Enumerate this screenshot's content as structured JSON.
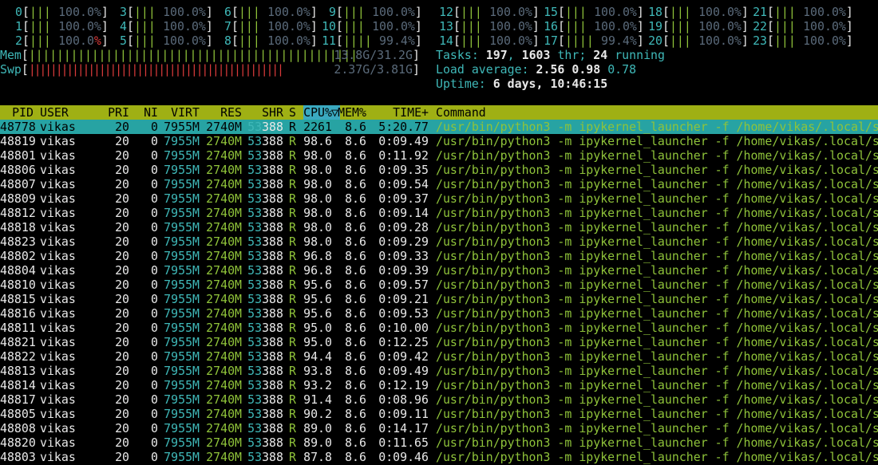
{
  "cpus": [
    {
      "id": "0",
      "bars": "|||",
      "pct": "100.0%"
    },
    {
      "id": "1",
      "bars": "|||",
      "pct": "100.0%"
    },
    {
      "id": "2",
      "bars": "|||",
      "pct": "100.0%"
    },
    {
      "id": "3",
      "bars": "|||",
      "pct": "100.0%"
    },
    {
      "id": "4",
      "bars": "|||",
      "pct": "100.0%"
    },
    {
      "id": "5",
      "bars": "|||",
      "pct": "100.0%"
    },
    {
      "id": "6",
      "bars": "|||",
      "pct": "100.0%"
    },
    {
      "id": "7",
      "bars": "|||",
      "pct": "100.0%"
    },
    {
      "id": "8",
      "bars": "|||",
      "pct": "100.0%"
    },
    {
      "id": "9",
      "bars": "|||",
      "pct": "100.0%"
    },
    {
      "id": "10",
      "bars": "|||",
      "pct": "100.0%"
    },
    {
      "id": "11",
      "bars": "||||",
      "pct": "99.4%"
    },
    {
      "id": "12",
      "bars": "|||",
      "pct": "100.0%"
    },
    {
      "id": "13",
      "bars": "|||",
      "pct": "100.0%"
    },
    {
      "id": "14",
      "bars": "|||",
      "pct": "100.0%"
    },
    {
      "id": "15",
      "bars": "|||",
      "pct": "100.0%"
    },
    {
      "id": "16",
      "bars": "|||",
      "pct": "100.0%"
    },
    {
      "id": "17",
      "bars": "||||",
      "pct": "99.4%"
    },
    {
      "id": "18",
      "bars": "|||",
      "pct": "100.0%"
    },
    {
      "id": "19",
      "bars": "|||",
      "pct": "100.0%"
    },
    {
      "id": "20",
      "bars": "|||",
      "pct": "100.0%"
    },
    {
      "id": "21",
      "bars": "|||",
      "pct": "100.0%"
    },
    {
      "id": "22",
      "bars": "|||",
      "pct": "100.0%"
    },
    {
      "id": "23",
      "bars": "|||",
      "pct": "100.0%"
    }
  ],
  "mem": {
    "label": "Mem",
    "bars": "|||||||||||||||||||||||||||||||||||||||||||||||",
    "value": "13.8G/31.2G"
  },
  "swp": {
    "label": "Swp",
    "bars": "|||||||||||||||||||||||||||||||||||||||||||||||",
    "value": "2.37G/3.81G"
  },
  "tasks": {
    "label": "Tasks:",
    "count": "197",
    "sep": ",",
    "thr": "1603",
    "thr_label": "thr;",
    "running": "24",
    "running_label": "running"
  },
  "load": {
    "label": "Load average:",
    "v1": "2.56",
    "v5": "0.98",
    "v15": "0.78"
  },
  "uptime": {
    "label": "Uptime:",
    "value": "6 days, 10:46:15"
  },
  "colors": {
    "header_bg": "#9fb014",
    "sort_bg": "#3aa9c0",
    "selected_bg": "#27a3a3"
  },
  "columns": {
    "pid": "PID",
    "user": "USER",
    "pri": "PRI",
    "ni": "NI",
    "virt": "VIRT",
    "res": "RES",
    "shr": "SHR",
    "s": "S",
    "cpu": "CPU%",
    "sort_arrow": "▽",
    "mem": "MEM%",
    "time": "TIME+",
    "command": "Command"
  },
  "command": {
    "prog": "/usr/bin/python3",
    "args": " -m ipykernel_launcher -f /home/vikas/.local/sha"
  },
  "processes": [
    {
      "pid": "48778",
      "user": "vikas",
      "pri": "20",
      "ni": "0",
      "virt": "7955M",
      "res": "2740M",
      "shr_a": "53",
      "shr_b": "388",
      "s": "R",
      "cpu": "2261",
      "mem": "8.6",
      "time": "5:20.77"
    },
    {
      "pid": "48819",
      "user": "vikas",
      "pri": "20",
      "ni": "0",
      "virt": "7955M",
      "res": "2740M",
      "shr_a": "53",
      "shr_b": "388",
      "s": "R",
      "cpu": "98.6",
      "mem": "8.6",
      "time": "0:09.49"
    },
    {
      "pid": "48801",
      "user": "vikas",
      "pri": "20",
      "ni": "0",
      "virt": "7955M",
      "res": "2740M",
      "shr_a": "53",
      "shr_b": "388",
      "s": "R",
      "cpu": "98.0",
      "mem": "8.6",
      "time": "0:11.92"
    },
    {
      "pid": "48806",
      "user": "vikas",
      "pri": "20",
      "ni": "0",
      "virt": "7955M",
      "res": "2740M",
      "shr_a": "53",
      "shr_b": "388",
      "s": "R",
      "cpu": "98.0",
      "mem": "8.6",
      "time": "0:09.35"
    },
    {
      "pid": "48807",
      "user": "vikas",
      "pri": "20",
      "ni": "0",
      "virt": "7955M",
      "res": "2740M",
      "shr_a": "53",
      "shr_b": "388",
      "s": "R",
      "cpu": "98.0",
      "mem": "8.6",
      "time": "0:09.54"
    },
    {
      "pid": "48809",
      "user": "vikas",
      "pri": "20",
      "ni": "0",
      "virt": "7955M",
      "res": "2740M",
      "shr_a": "53",
      "shr_b": "388",
      "s": "R",
      "cpu": "98.0",
      "mem": "8.6",
      "time": "0:09.37"
    },
    {
      "pid": "48812",
      "user": "vikas",
      "pri": "20",
      "ni": "0",
      "virt": "7955M",
      "res": "2740M",
      "shr_a": "53",
      "shr_b": "388",
      "s": "R",
      "cpu": "98.0",
      "mem": "8.6",
      "time": "0:09.14"
    },
    {
      "pid": "48818",
      "user": "vikas",
      "pri": "20",
      "ni": "0",
      "virt": "7955M",
      "res": "2740M",
      "shr_a": "53",
      "shr_b": "388",
      "s": "R",
      "cpu": "98.0",
      "mem": "8.6",
      "time": "0:09.28"
    },
    {
      "pid": "48823",
      "user": "vikas",
      "pri": "20",
      "ni": "0",
      "virt": "7955M",
      "res": "2740M",
      "shr_a": "53",
      "shr_b": "388",
      "s": "R",
      "cpu": "98.0",
      "mem": "8.6",
      "time": "0:09.29"
    },
    {
      "pid": "48802",
      "user": "vikas",
      "pri": "20",
      "ni": "0",
      "virt": "7955M",
      "res": "2740M",
      "shr_a": "53",
      "shr_b": "388",
      "s": "R",
      "cpu": "96.8",
      "mem": "8.6",
      "time": "0:09.33"
    },
    {
      "pid": "48804",
      "user": "vikas",
      "pri": "20",
      "ni": "0",
      "virt": "7955M",
      "res": "2740M",
      "shr_a": "53",
      "shr_b": "388",
      "s": "R",
      "cpu": "96.8",
      "mem": "8.6",
      "time": "0:09.39"
    },
    {
      "pid": "48810",
      "user": "vikas",
      "pri": "20",
      "ni": "0",
      "virt": "7955M",
      "res": "2740M",
      "shr_a": "53",
      "shr_b": "388",
      "s": "R",
      "cpu": "95.6",
      "mem": "8.6",
      "time": "0:09.57"
    },
    {
      "pid": "48815",
      "user": "vikas",
      "pri": "20",
      "ni": "0",
      "virt": "7955M",
      "res": "2740M",
      "shr_a": "53",
      "shr_b": "388",
      "s": "R",
      "cpu": "95.6",
      "mem": "8.6",
      "time": "0:09.21"
    },
    {
      "pid": "48816",
      "user": "vikas",
      "pri": "20",
      "ni": "0",
      "virt": "7955M",
      "res": "2740M",
      "shr_a": "53",
      "shr_b": "388",
      "s": "R",
      "cpu": "95.6",
      "mem": "8.6",
      "time": "0:09.53"
    },
    {
      "pid": "48811",
      "user": "vikas",
      "pri": "20",
      "ni": "0",
      "virt": "7955M",
      "res": "2740M",
      "shr_a": "53",
      "shr_b": "388",
      "s": "R",
      "cpu": "95.0",
      "mem": "8.6",
      "time": "0:10.00"
    },
    {
      "pid": "48821",
      "user": "vikas",
      "pri": "20",
      "ni": "0",
      "virt": "7955M",
      "res": "2740M",
      "shr_a": "53",
      "shr_b": "388",
      "s": "R",
      "cpu": "95.0",
      "mem": "8.6",
      "time": "0:12.25"
    },
    {
      "pid": "48822",
      "user": "vikas",
      "pri": "20",
      "ni": "0",
      "virt": "7955M",
      "res": "2740M",
      "shr_a": "53",
      "shr_b": "388",
      "s": "R",
      "cpu": "94.4",
      "mem": "8.6",
      "time": "0:09.42"
    },
    {
      "pid": "48813",
      "user": "vikas",
      "pri": "20",
      "ni": "0",
      "virt": "7955M",
      "res": "2740M",
      "shr_a": "53",
      "shr_b": "388",
      "s": "R",
      "cpu": "93.8",
      "mem": "8.6",
      "time": "0:09.49"
    },
    {
      "pid": "48814",
      "user": "vikas",
      "pri": "20",
      "ni": "0",
      "virt": "7955M",
      "res": "2740M",
      "shr_a": "53",
      "shr_b": "388",
      "s": "R",
      "cpu": "93.2",
      "mem": "8.6",
      "time": "0:12.19"
    },
    {
      "pid": "48817",
      "user": "vikas",
      "pri": "20",
      "ni": "0",
      "virt": "7955M",
      "res": "2740M",
      "shr_a": "53",
      "shr_b": "388",
      "s": "R",
      "cpu": "91.4",
      "mem": "8.6",
      "time": "0:08.96"
    },
    {
      "pid": "48805",
      "user": "vikas",
      "pri": "20",
      "ni": "0",
      "virt": "7955M",
      "res": "2740M",
      "shr_a": "53",
      "shr_b": "388",
      "s": "R",
      "cpu": "90.2",
      "mem": "8.6",
      "time": "0:09.11"
    },
    {
      "pid": "48808",
      "user": "vikas",
      "pri": "20",
      "ni": "0",
      "virt": "7955M",
      "res": "2740M",
      "shr_a": "53",
      "shr_b": "388",
      "s": "R",
      "cpu": "89.0",
      "mem": "8.6",
      "time": "0:14.17"
    },
    {
      "pid": "48820",
      "user": "vikas",
      "pri": "20",
      "ni": "0",
      "virt": "7955M",
      "res": "2740M",
      "shr_a": "53",
      "shr_b": "388",
      "s": "R",
      "cpu": "89.0",
      "mem": "8.6",
      "time": "0:11.65"
    },
    {
      "pid": "48803",
      "user": "vikas",
      "pri": "20",
      "ni": "0",
      "virt": "7955M",
      "res": "2740M",
      "shr_a": "53",
      "shr_b": "388",
      "s": "R",
      "cpu": "87.8",
      "mem": "8.6",
      "time": "0:09.46"
    }
  ]
}
